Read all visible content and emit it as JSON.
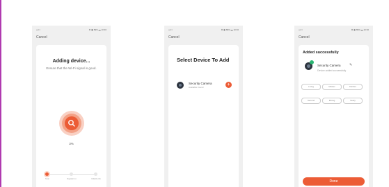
{
  "colors": {
    "accent": "#ec5c36",
    "success": "#2bb673",
    "page_border": "#b03ab0"
  },
  "status_bar": {
    "left": "••ıl ≈",
    "right": "⚙ ▣ 89% ▬ 10:30"
  },
  "screen1": {
    "cancel": "Cancel",
    "title": "Adding device...",
    "subtitle": "Ensure that the Wi-Fi signal is good.",
    "icon": "search-icon",
    "progress_percent": 3,
    "progress_text": "3%",
    "steps": [
      "Scan",
      "Register on",
      "Initialize the"
    ],
    "active_step": 0
  },
  "screen2": {
    "cancel": "Cancel",
    "title": "Select Device To Add",
    "device": {
      "name": "Security Camera",
      "status": "Available Found",
      "icon": "camera-icon",
      "action_icon": "plus-icon"
    }
  },
  "screen3": {
    "cancel": "Cancel",
    "title": "Added successfully",
    "device": {
      "name": "Security Camera",
      "status": "Device added successfully",
      "icon": "camera-icon",
      "edit_icon": "pencil-icon"
    },
    "rooms": [
      "Living",
      "Master",
      "Kitchen",
      "Second",
      "Dining",
      "Study"
    ],
    "done_label": "Done"
  }
}
